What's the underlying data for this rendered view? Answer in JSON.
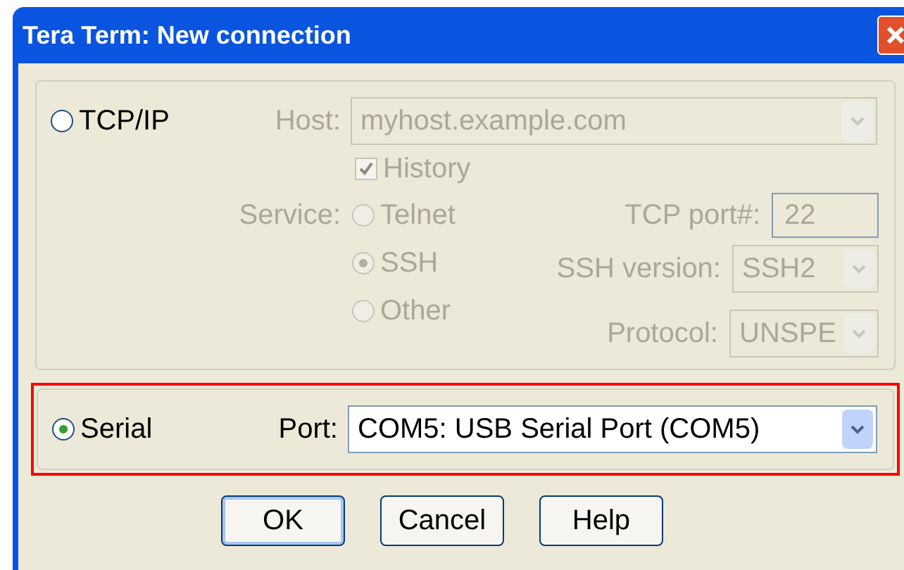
{
  "window": {
    "title": "Tera Term: New connection"
  },
  "tcpip": {
    "label": "TCP/IP",
    "selected": false,
    "disabled": true,
    "host": {
      "label": "Host:",
      "value": "myhost.example.com"
    },
    "history": {
      "label": "History",
      "checked": true
    },
    "service": {
      "label": "Service:",
      "options": [
        {
          "label": "Telnet",
          "selected": false
        },
        {
          "label": "SSH",
          "selected": true
        },
        {
          "label": "Other",
          "selected": false
        }
      ]
    },
    "tcp_port": {
      "label": "TCP port#:",
      "value": "22"
    },
    "ssh_version": {
      "label": "SSH version:",
      "value": "SSH2"
    },
    "protocol": {
      "label": "Protocol:",
      "value": "UNSPE"
    }
  },
  "serial": {
    "label": "Serial",
    "selected": true,
    "highlighted": true,
    "port": {
      "label": "Port:",
      "value": "COM5: USB Serial Port (COM5)"
    }
  },
  "buttons": [
    {
      "label": "OK",
      "default": true
    },
    {
      "label": "Cancel",
      "default": false
    },
    {
      "label": "Help",
      "default": false
    }
  ]
}
